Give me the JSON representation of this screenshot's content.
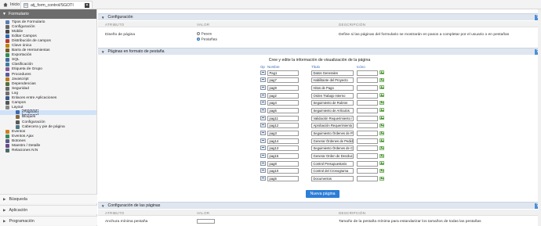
{
  "tabs": {
    "home": "Inicio",
    "active": "atj_form_control/SGOTI"
  },
  "sidebar": {
    "header": "Formulario",
    "items": [
      {
        "label": "Tipos de Formulario",
        "icon": "form-type-icon",
        "indent": 0
      },
      {
        "label": "Configuración",
        "icon": "gear-icon",
        "indent": 0
      },
      {
        "label": "Mobile",
        "icon": "mobile-icon",
        "indent": 0
      },
      {
        "label": "Editar Campos",
        "icon": "edit-icon",
        "indent": 0
      },
      {
        "label": "Distribución de campos",
        "icon": "layout-icon",
        "indent": 0
      },
      {
        "label": "Clave única",
        "icon": "key-icon",
        "indent": 0
      },
      {
        "label": "Barra de Herramientas",
        "icon": "toolbar-icon",
        "indent": 0
      },
      {
        "label": "Exportación",
        "icon": "export-icon",
        "indent": 0
      },
      {
        "label": "SQL",
        "icon": "sql-icon",
        "indent": 0
      },
      {
        "label": "Clasificación",
        "icon": "sort-icon",
        "indent": 0
      },
      {
        "label": "Etiqueta de Grupo",
        "icon": "tag-icon",
        "indent": 0
      },
      {
        "label": "Procedures",
        "icon": "procedure-icon",
        "indent": 0
      },
      {
        "label": "Javascript",
        "icon": "javascript-icon",
        "indent": 0
      },
      {
        "label": "Dependencias",
        "icon": "dependency-icon",
        "indent": 0
      },
      {
        "label": "Seguridad",
        "icon": "lock-icon",
        "indent": 0
      },
      {
        "label": "Log",
        "icon": "log-icon",
        "indent": 0
      },
      {
        "label": "Enlaces entre Aplicaciones",
        "icon": "link-icon",
        "indent": 0
      },
      {
        "label": "Campos",
        "icon": "fields-icon",
        "indent": 0
      },
      {
        "label": "Layout",
        "icon": "layout-folder-icon",
        "indent": 0
      },
      {
        "label": "Páginas",
        "icon": "pages-icon",
        "indent": 1,
        "selected": true
      },
      {
        "label": "Bloques",
        "icon": "blocks-icon",
        "indent": 1
      },
      {
        "label": "Configuración",
        "icon": "config-icon",
        "indent": 1
      },
      {
        "label": "Cabecera y pie de página",
        "icon": "header-footer-icon",
        "indent": 1
      },
      {
        "label": "Eventos",
        "icon": "events-icon",
        "indent": 0
      },
      {
        "label": "Eventos Ajax",
        "icon": "ajax-icon",
        "indent": 0
      },
      {
        "label": "Botones",
        "icon": "buttons-icon",
        "indent": 0
      },
      {
        "label": "Maestro / Detalle",
        "icon": "master-detail-icon",
        "indent": 0
      },
      {
        "label": "Relaciones N:N",
        "icon": "relations-icon",
        "indent": 0
      }
    ],
    "sections": [
      "Búsqueda",
      "Aplicación",
      "Programación"
    ]
  },
  "config_section": {
    "title": "Configuración",
    "col_attr": "ATRIBUTO",
    "col_value": "VALOR",
    "col_desc": "DESCRIPCIÓN",
    "attr": "Diseño de página",
    "options": [
      "Pasos",
      "Pestañas"
    ],
    "selected_option": "Pestañas",
    "desc": "Define si las páginas del formulario se mostrarán en pasos a completar por el usuario o en pestañas"
  },
  "pages_section": {
    "title": "Páginas en formato de pestaña",
    "caption": "Cree y edite la información de visualización de la página",
    "headers": {
      "op": "Op",
      "name": "Nombre",
      "title": "Título",
      "icon": "Icóno"
    },
    "rows": [
      {
        "name": "Pag1",
        "title": "Datos Generales"
      },
      {
        "name": "pag7",
        "title": "Habilitante del Proyecto"
      },
      {
        "name": "pag9",
        "title": "Hitos de Pago"
      },
      {
        "name": "pag2",
        "title": "Orden Trabajo Interno"
      },
      {
        "name": "pag4",
        "title": "Seguimiento de Rubros"
      },
      {
        "name": "pag6",
        "title": "Seguimiento de Artículos"
      },
      {
        "name": "pag11",
        "title": "Validación Requerimiento / Orden"
      },
      {
        "name": "pag12",
        "title": "Aprobación Requerimiento"
      },
      {
        "name": "pag3",
        "title": "Seguimiento Órdenes de Pedido"
      },
      {
        "name": "pag14",
        "title": "Generar Órdenes de Pedido"
      },
      {
        "name": "pag13",
        "title": "Seguimiento Órdenes de Compra"
      },
      {
        "name": "pag15",
        "title": "Generar Orden de Devolución"
      },
      {
        "name": "pag8",
        "title": "Control Presupuestario"
      },
      {
        "name": "pag10",
        "title": "Control del Cronograma"
      },
      {
        "name": "pag5",
        "title": "Documentos"
      }
    ],
    "new_button": "Nueva página"
  },
  "pages_config_section": {
    "title": "Configuración de las páginas",
    "col_attr": "ATRIBUTO",
    "col_value": "VALOR",
    "col_desc": "DESCRIPCIÓN",
    "attr": "Anchura mínima pestaña",
    "desc": "Tamaño de la pestaña mínima para estandarizar los tamaños de todas las pestañas"
  },
  "colors": {
    "accent": "#2c7ed6",
    "section_bg": "#dfe6ef",
    "sidebar_head": "#6c6c6c"
  }
}
